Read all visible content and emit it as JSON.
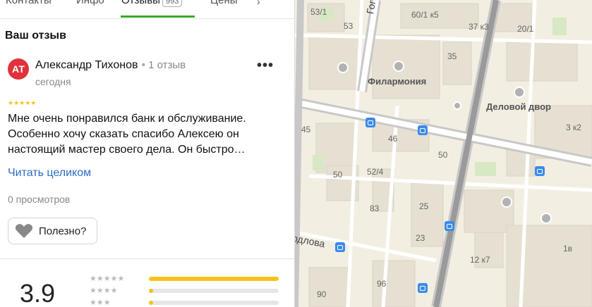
{
  "tabs": [
    {
      "label": "Контакты"
    },
    {
      "label": "Инфо"
    },
    {
      "label": "Отзывы",
      "count": "993"
    },
    {
      "label": "Цены"
    }
  ],
  "section_title": "Ваш отзыв",
  "review": {
    "avatar_initials": "АТ",
    "author": "Александр Тихонов",
    "reviews_count": "1 отзыв",
    "date": "сегодня",
    "stars": "★★★★★",
    "text": "Мне очень понравился банк и обслуживание. Особенно хочу сказать спасибо Алексею он настоящий мастер своего дела. Он быстро…",
    "read_more": "Читать целиком",
    "views": "0 просмотров",
    "useful_label": "Полезно?"
  },
  "rating": {
    "value": "3.9",
    "distribution": [
      {
        "stars": "★★★★★",
        "fraction": 1.0
      },
      {
        "stars": "★★★★",
        "fraction": 0.03
      },
      {
        "stars": "★★★",
        "fraction": 0.03
      }
    ]
  },
  "colors": {
    "accent_green": "#3ca82b",
    "avatar_red": "#e0323a",
    "star_yellow": "#f8c21b",
    "link_blue": "#2c6ec4",
    "bus_blue": "#3a8be8"
  },
  "map": {
    "labels": {
      "philharmonic": "Филармония",
      "business_yard": "Деловой двор",
      "street_sverdlova": "рдлова",
      "street_gog": "Гог"
    },
    "house_numbers": {
      "h53_1": "53/1",
      "h53": "53",
      "h60_1": "60/1 к5",
      "h37": "37 к3",
      "h20_1": "20/1",
      "h35": "35",
      "h45": "45",
      "h46": "46",
      "h50a": "50",
      "h50b": "50",
      "h52_4": "52/4",
      "h83": "83",
      "h25": "25",
      "h23": "23",
      "h3": "3 к2",
      "h12": "12 к7",
      "h1v": "1в",
      "h96": "96",
      "h90": "90"
    }
  }
}
